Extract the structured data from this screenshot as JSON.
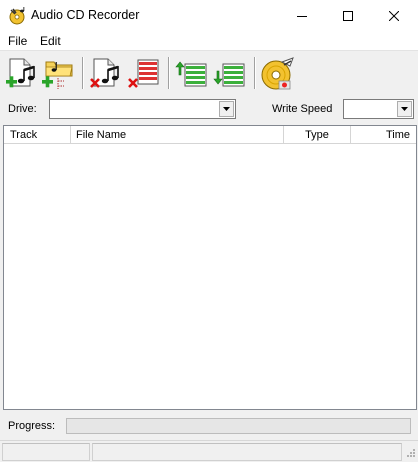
{
  "window": {
    "title": "Audio CD Recorder"
  },
  "menu": {
    "file": "File",
    "edit": "Edit"
  },
  "toolbar": {
    "buttons": [
      {
        "name": "add-track-icon"
      },
      {
        "name": "add-folder-icon"
      },
      {
        "name": "remove-track-icon"
      },
      {
        "name": "remove-all-icon"
      },
      {
        "name": "move-up-icon"
      },
      {
        "name": "move-down-icon"
      },
      {
        "name": "burn-cd-icon"
      }
    ]
  },
  "drive": {
    "label": "Drive:",
    "value": ""
  },
  "write_speed": {
    "label": "Write Speed",
    "value": ""
  },
  "tracklist": {
    "columns": [
      "Track",
      "File Name",
      "Type",
      "Time"
    ],
    "rows": []
  },
  "progress": {
    "label": "Progress:",
    "value": 0
  },
  "colors": {
    "accent": "#06b025",
    "list_border": "#828790"
  }
}
